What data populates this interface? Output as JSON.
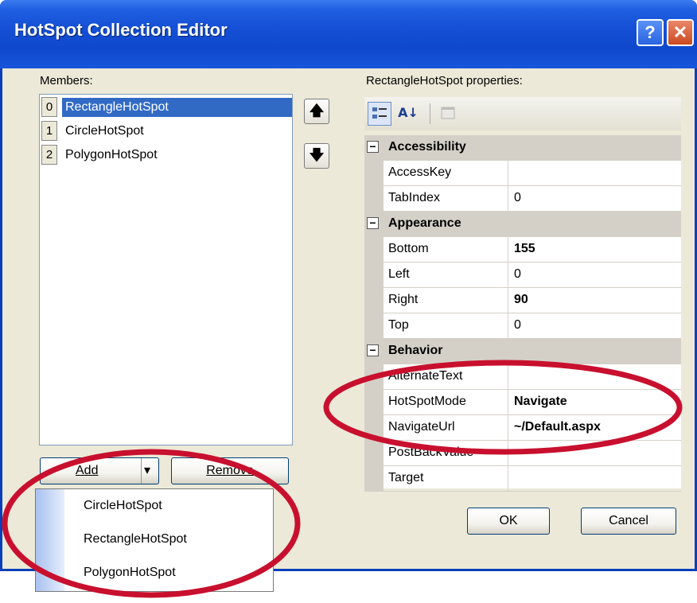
{
  "window": {
    "title": "HotSpot Collection Editor"
  },
  "titlebar": {
    "help_glyph": "?",
    "close_glyph": "✕"
  },
  "members": {
    "label": "Members:",
    "items": [
      {
        "index": "0",
        "label": "RectangleHotSpot",
        "selected": true
      },
      {
        "index": "1",
        "label": "CircleHotSpot",
        "selected": false
      },
      {
        "index": "2",
        "label": "PolygonHotSpot",
        "selected": false
      }
    ]
  },
  "move_up": {
    "glyph": "🡅"
  },
  "move_down": {
    "glyph": "🡇"
  },
  "buttons": {
    "add": "Add",
    "add_dropdown": "▾",
    "remove": "Remove",
    "ok": "OK",
    "cancel": "Cancel"
  },
  "properties": {
    "label": "RectangleHotSpot properties:",
    "toolbar": {
      "categorized_icon": "categorized-icon",
      "alphabetical_glyph": "A↓",
      "pages_icon": "property-pages-icon"
    },
    "categories": [
      {
        "name": "Accessibility",
        "toggle": "⊟",
        "props": [
          {
            "name": "AccessKey",
            "value": ""
          },
          {
            "name": "TabIndex",
            "value": "0"
          }
        ]
      },
      {
        "name": "Appearance",
        "toggle": "⊟",
        "props": [
          {
            "name": "Bottom",
            "value": "155"
          },
          {
            "name": "Left",
            "value": "0"
          },
          {
            "name": "Right",
            "value": "90"
          },
          {
            "name": "Top",
            "value": "0"
          }
        ]
      },
      {
        "name": "Behavior",
        "toggle": "⊟",
        "props": [
          {
            "name": "AlternateText",
            "value": ""
          },
          {
            "name": "HotSpotMode",
            "value": "Navigate"
          },
          {
            "name": "NavigateUrl",
            "value": "~/Default.aspx"
          },
          {
            "name": "PostBackValue",
            "value": ""
          },
          {
            "name": "Target",
            "value": ""
          }
        ]
      }
    ]
  },
  "add_menu": {
    "items": [
      "CircleHotSpot",
      "RectangleHotSpot",
      "PolygonHotSpot"
    ]
  },
  "colors": {
    "titlebar": "#1550d6",
    "selection": "#316ac5",
    "annotation": "#c8102e",
    "dialog": "#ece9d8"
  }
}
